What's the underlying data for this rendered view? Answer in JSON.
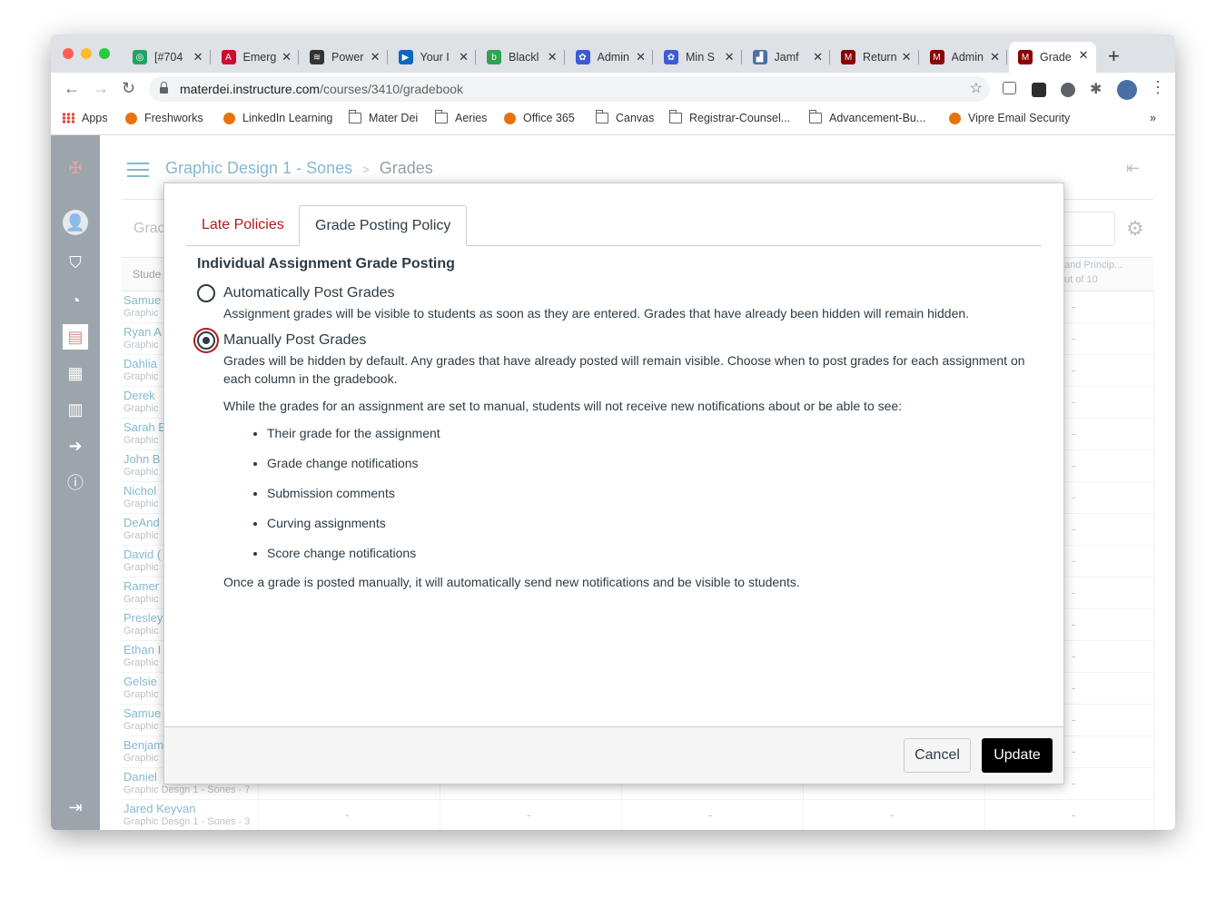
{
  "browser": {
    "tabs": [
      {
        "title": "[#704",
        "color": "#1fa463",
        "glyph": "◎"
      },
      {
        "title": "Emerg",
        "color": "#c8102e",
        "glyph": "A"
      },
      {
        "title": "Power",
        "color": "#333333",
        "glyph": "≋"
      },
      {
        "title": "Your I",
        "color": "#0a66c2",
        "glyph": "▶"
      },
      {
        "title": "Blackl",
        "color": "#2ea44f",
        "glyph": "b"
      },
      {
        "title": "Admin",
        "color": "#3b5bdb",
        "glyph": "✿"
      },
      {
        "title": "Min S",
        "color": "#3b5bdb",
        "glyph": "✿"
      },
      {
        "title": "Jamf",
        "color": "#4a6fa5",
        "glyph": "▟"
      },
      {
        "title": "Return",
        "color": "#8b0000",
        "glyph": "M"
      },
      {
        "title": "Admin",
        "color": "#8b0000",
        "glyph": "M"
      },
      {
        "title": "Grade",
        "color": "#8b0000",
        "glyph": "M"
      }
    ],
    "url_host": "materdei.instructure.com",
    "url_path": "/courses/3410/gradebook",
    "bookmarks": [
      {
        "label": "Apps",
        "type": "apps"
      },
      {
        "label": "Freshworks",
        "type": "site"
      },
      {
        "label": "LinkedIn Learning",
        "type": "site"
      },
      {
        "label": "Mater Dei",
        "type": "folder"
      },
      {
        "label": "Aeries",
        "type": "folder"
      },
      {
        "label": "Office 365",
        "type": "site"
      },
      {
        "label": "Canvas",
        "type": "folder"
      },
      {
        "label": "Registrar-Counsel...",
        "type": "folder"
      },
      {
        "label": "Advancement-Bu...",
        "type": "folder"
      },
      {
        "label": "Vipre Email Security",
        "type": "site"
      }
    ],
    "more": "»"
  },
  "canvas": {
    "breadcrumb_course": "Graphic Design 1 - Sones",
    "breadcrumb_sep": ">",
    "breadcrumb_page": "Grades",
    "gradebook_label": "Grac",
    "student_header": "Stude",
    "assignment_header_1": "and Princip...",
    "assignment_header_2": "ut of 10",
    "students": [
      {
        "name": "Samue",
        "section": "Graphic"
      },
      {
        "name": "Ryan A",
        "section": "Graphic"
      },
      {
        "name": "Dahlia",
        "section": "Graphic"
      },
      {
        "name": "Derek",
        "section": "Graphic"
      },
      {
        "name": "Sarah E",
        "section": "Graphic"
      },
      {
        "name": "John B",
        "section": "Graphic"
      },
      {
        "name": "Nichol",
        "section": "Graphic"
      },
      {
        "name": "DeAnd",
        "section": "Graphic"
      },
      {
        "name": "David (",
        "section": "Graphic"
      },
      {
        "name": "Ramer",
        "section": "Graphic"
      },
      {
        "name": "Presley",
        "section": "Graphic"
      },
      {
        "name": "Ethan I",
        "section": "Graphic"
      },
      {
        "name": "Gelsie",
        "section": "Graphic"
      },
      {
        "name": "Samue",
        "section": "Graphic"
      },
      {
        "name": "Benjam",
        "section": "Graphic"
      },
      {
        "name": "Daniel",
        "section": "Graphic Desgn 1 - Sones - 7"
      },
      {
        "name": "Jared Keyvan",
        "section": "Graphic Desgn 1 - Sones - 3"
      }
    ],
    "dash": "-"
  },
  "modal": {
    "tab_late": "Late Policies",
    "tab_posting": "Grade Posting Policy",
    "heading": "Individual Assignment Grade Posting",
    "auto_label": "Automatically Post Grades",
    "auto_desc": "Assignment grades will be visible to students as soon as they are entered. Grades that have already been hidden will remain hidden.",
    "manual_label": "Manually Post Grades",
    "manual_desc": "Grades will be hidden by default. Any grades that have already posted will remain visible. Choose when to post grades for each assignment on each column in the gradebook.",
    "manual_note": "While the grades for an assignment are set to manual, students will not receive new notifications about or be able to see:",
    "bullets": [
      "Their grade for the assignment",
      "Grade change notifications",
      "Submission comments",
      "Curving assignments",
      "Score change notifications"
    ],
    "footer_note": "Once a grade is posted manually, it will automatically send new notifications and be visible to students.",
    "cancel": "Cancel",
    "update": "Update"
  },
  "colors": {
    "canvas_red": "#ae1b1b",
    "text": "#2d3b45",
    "nav": "#394b58"
  }
}
